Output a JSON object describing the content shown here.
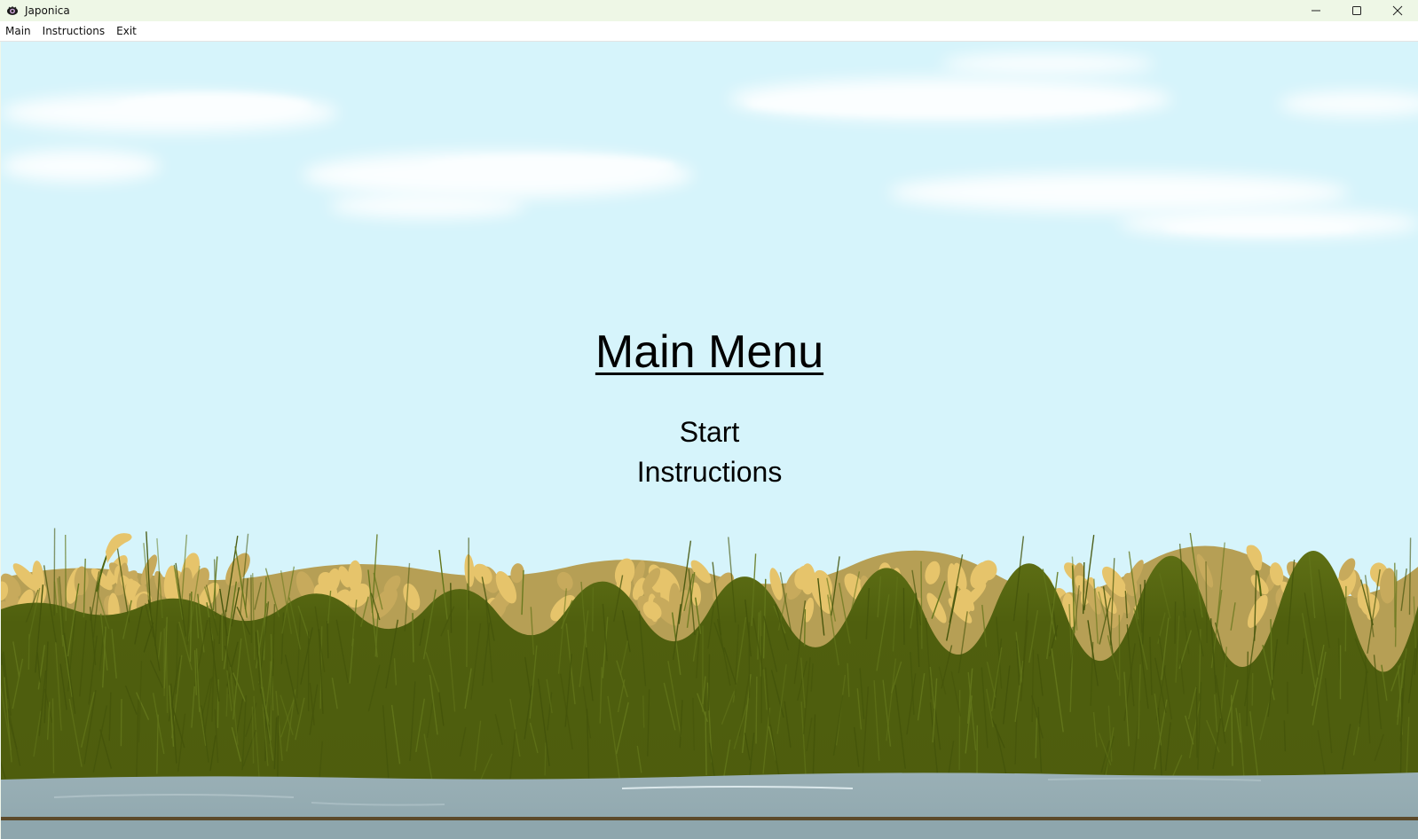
{
  "window": {
    "title": "Japonica",
    "icon": "app-eye-icon",
    "controls": [
      "minimize-icon",
      "maximize-icon",
      "close-icon"
    ]
  },
  "menubar": {
    "items": [
      {
        "label": "Main"
      },
      {
        "label": "Instructions"
      },
      {
        "label": "Exit"
      }
    ]
  },
  "game": {
    "title": "Main Menu",
    "options": [
      {
        "label": "Start"
      },
      {
        "label": "Instructions"
      }
    ],
    "colors": {
      "sky": "#d6f4fb",
      "grass": "#4f5e0e",
      "grain": "#e8c46a",
      "water": "#94abb2"
    }
  }
}
